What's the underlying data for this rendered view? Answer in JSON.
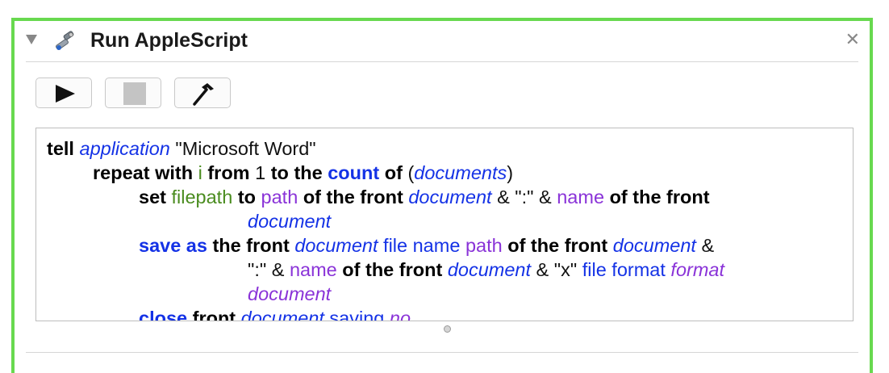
{
  "action": {
    "title": "Run AppleScript",
    "close_glyph": "✕",
    "icon": "applescript-action-icon"
  },
  "toolbar": {
    "buttons": [
      {
        "name": "run-button",
        "icon": "play-icon"
      },
      {
        "name": "stop-button",
        "icon": "stop-icon"
      },
      {
        "name": "compile-button",
        "icon": "hammer-icon"
      }
    ]
  },
  "colors": {
    "border_accent": "#68d94f",
    "keyword": "#000000",
    "application_keyword": "#1432e6",
    "variable": "#4a8c1f",
    "user_property": "#8a33d8"
  },
  "script": {
    "l1": {
      "t1": "tell",
      "t2": "application",
      "t3": "\"Microsoft Word\""
    },
    "l2": {
      "t1": "repeat with",
      "t2": "i",
      "t3": "from",
      "t4": "1",
      "t5": "to the",
      "t6": "count",
      "t7": "of",
      "t8": "(",
      "t9": "documents",
      "t10": ")"
    },
    "l3": {
      "t1": "set",
      "t2": "filepath",
      "t3": "to",
      "t4": "path",
      "t5": "of the front",
      "t6": "document",
      "t7": "& \":\" &",
      "t8": "name",
      "t9": "of the front"
    },
    "l4": {
      "t1": "document"
    },
    "l5": {
      "t1": "save as",
      "t2": "the front",
      "t3": "document",
      "t4": "file name",
      "t5": "path",
      "t6": "of the front",
      "t7": "document",
      "t8": "&"
    },
    "l6": {
      "t1": "\":\" &",
      "t2": "name",
      "t3": "of the front",
      "t4": "document",
      "t5": "& \"x\"",
      "t6": "file format",
      "t7": "format"
    },
    "l7": {
      "t1": "document"
    },
    "l8": {
      "t1": "close",
      "t2": "front",
      "t3": "document",
      "t4": "saving",
      "t5": "no"
    }
  }
}
